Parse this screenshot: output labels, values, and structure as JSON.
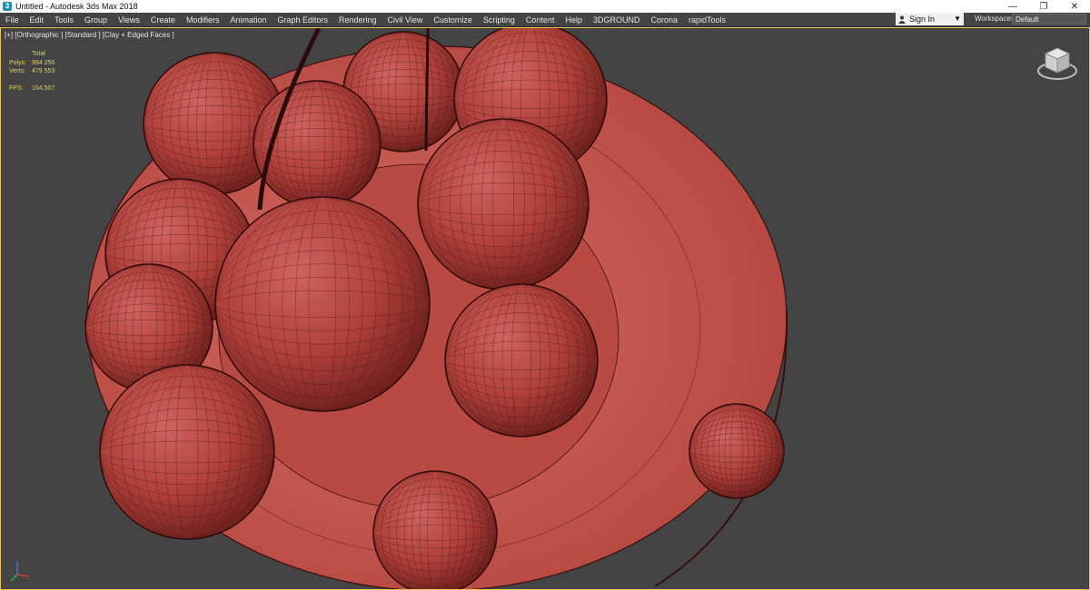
{
  "window": {
    "title": "Untitled - Autodesk 3ds Max 2018",
    "controls": [
      "—",
      "❐",
      "✕"
    ]
  },
  "menu": [
    "File",
    "Edit",
    "Tools",
    "Group",
    "Views",
    "Create",
    "Modifiers",
    "Animation",
    "Graph Editors",
    "Rendering",
    "Civil View",
    "Customize",
    "Scripting",
    "Content",
    "Help",
    "3DGROUND",
    "Corona",
    "rapidTools"
  ],
  "account": {
    "signin_label": "Sign In"
  },
  "workspaces": {
    "label": "Workspaces:",
    "value": "Default"
  },
  "viewport": {
    "label": "[+] [Orthographic ] [Standard ] [Clay + Edged Faces ]",
    "stats": {
      "header": "Total",
      "polys_label": "Polys:",
      "polys": "994 256",
      "verts_label": "Verts:",
      "verts": "479 553",
      "fps_label": "FPS:",
      "fps": "154,507"
    }
  },
  "colors": {
    "viewport_bg": "#444444",
    "clay": "#b3443f",
    "wire": "#3a0f0e",
    "stats_text": "#e8d23a",
    "active_border": "#e7c54a"
  },
  "icons": [
    "app-icon",
    "user-icon",
    "viewcube-icon",
    "axis-tripod-icon"
  ]
}
